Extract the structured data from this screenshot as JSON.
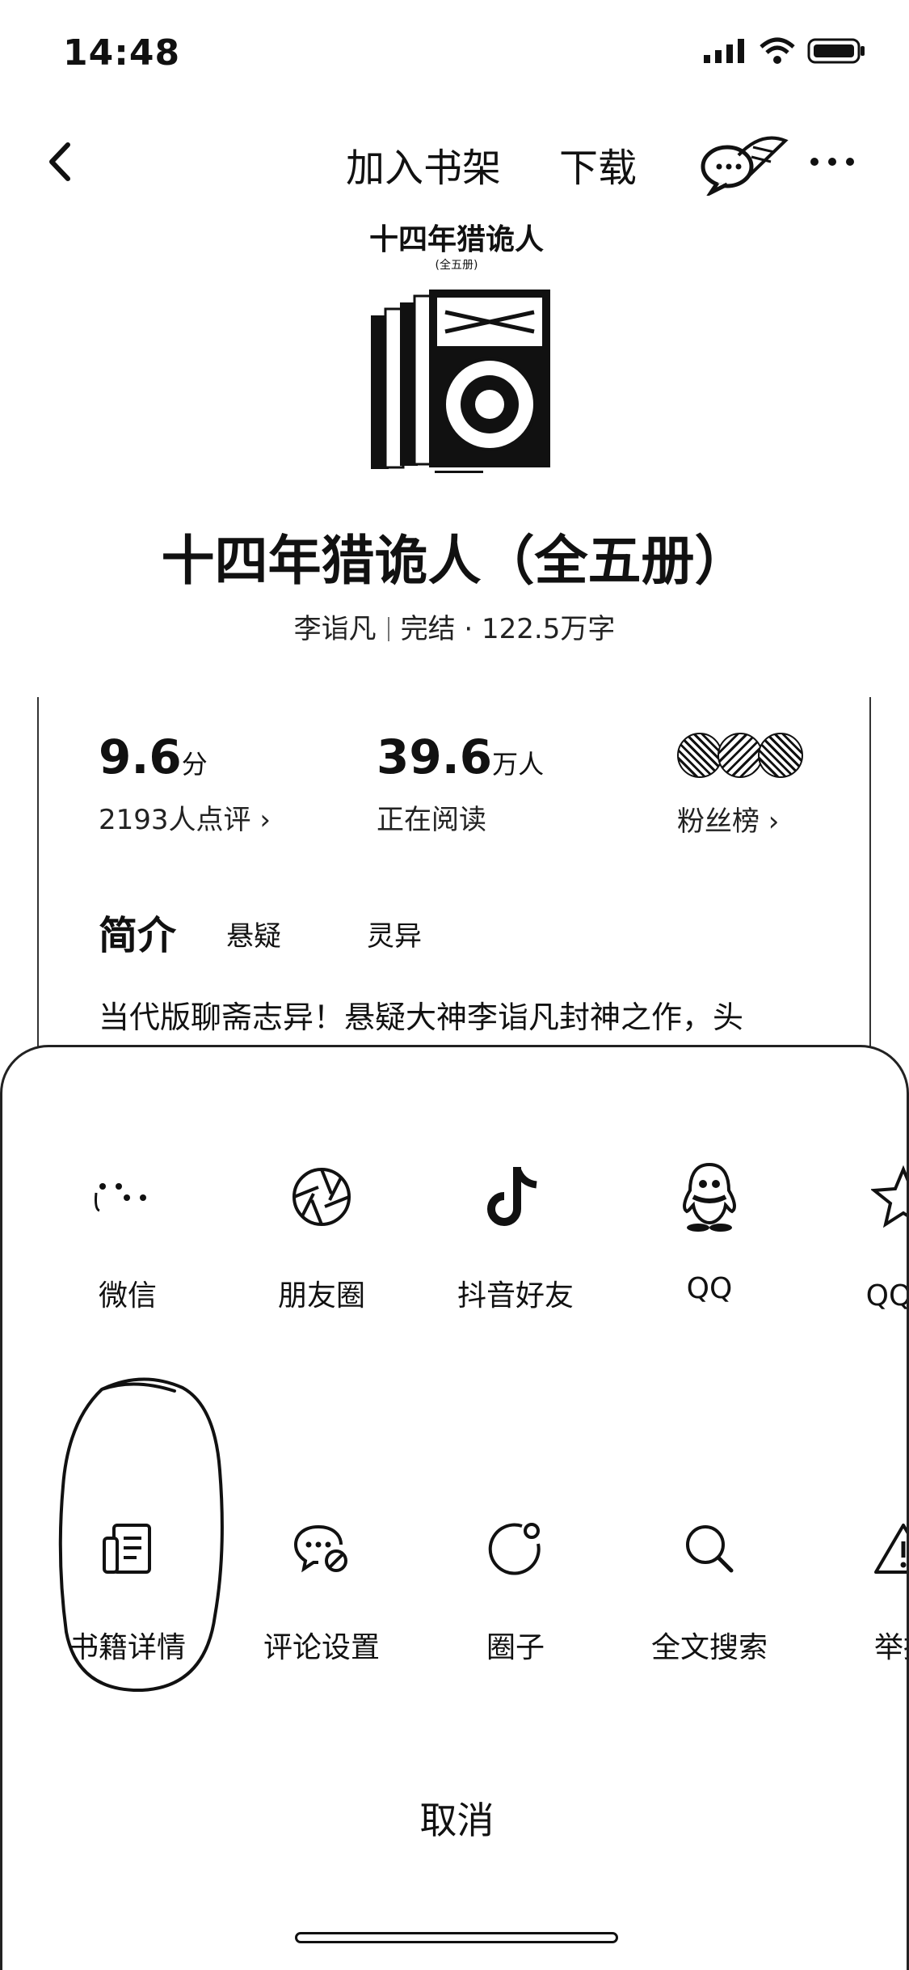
{
  "status_bar": {
    "time": "14:48"
  },
  "nav": {
    "add_to_shelf": "加入书架",
    "download": "下载"
  },
  "cover": {
    "title": "十四年猎诡人",
    "subtitle": "(全五册)"
  },
  "book": {
    "title": "十四年猎诡人（全五册）",
    "author": "李诣凡",
    "status": "完结 · 122.5万字"
  },
  "stats": {
    "score": {
      "value": "9.6",
      "unit": "分",
      "label": "2193人点评 ›"
    },
    "readers": {
      "value": "39.6",
      "unit": "万人",
      "label": "正在阅读"
    },
    "fans": {
      "label": "粉丝榜 ›"
    }
  },
  "intro": {
    "heading": "简介",
    "tags": [
      "悬疑",
      "灵异"
    ],
    "text": "当代版聊斋志异！悬疑大神李诣凡封神之作，头"
  },
  "share_row": [
    {
      "label": "微信",
      "icon": "wechat-icon"
    },
    {
      "label": "朋友圈",
      "icon": "moments-icon"
    },
    {
      "label": "抖音好友",
      "icon": "douyin-icon"
    },
    {
      "label": "QQ",
      "icon": "qq-icon"
    },
    {
      "label": "QQ空",
      "icon": "qzone-icon"
    }
  ],
  "action_row": [
    {
      "label": "书籍详情",
      "icon": "book-detail-icon"
    },
    {
      "label": "评论设置",
      "icon": "comment-settings-icon"
    },
    {
      "label": "圈子",
      "icon": "circle-icon"
    },
    {
      "label": "全文搜索",
      "icon": "search-icon"
    },
    {
      "label": "举报",
      "icon": "report-icon"
    }
  ],
  "cancel": "取消"
}
